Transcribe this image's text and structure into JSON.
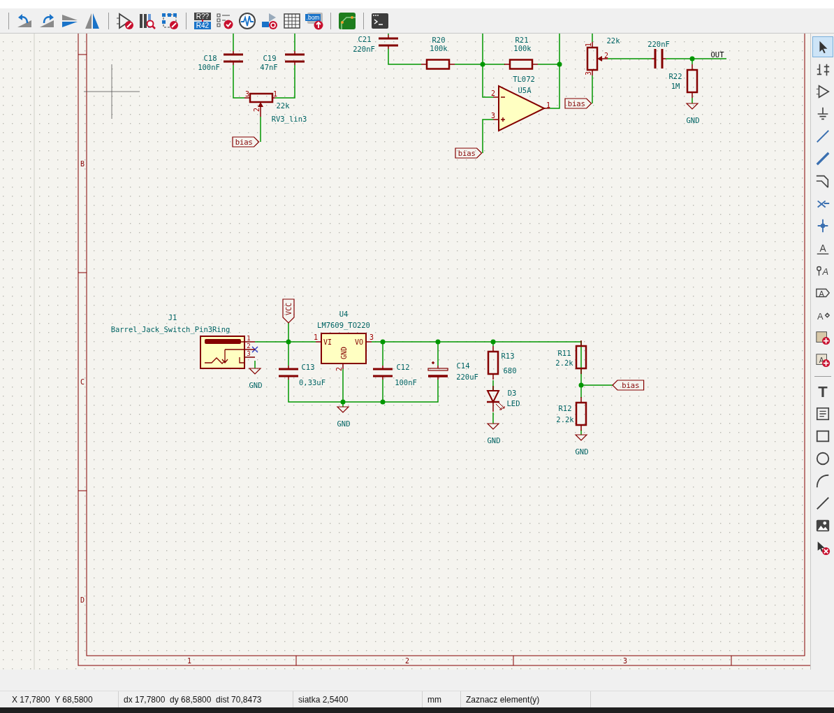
{
  "toolbar": {
    "annotate_icon": {
      "before": "R??",
      "after": "R42"
    },
    "bom_icon": ".bom"
  },
  "schematic": {
    "sheet": {
      "rows": [
        "B",
        "C",
        "D"
      ],
      "columns": [
        "1",
        "2",
        "3"
      ]
    },
    "components": [
      {
        "kind": "capacitor",
        "ref": "C18",
        "value": "100nF"
      },
      {
        "kind": "capacitor",
        "ref": "C19",
        "value": "47nF"
      },
      {
        "kind": "potentiometer",
        "ref": "RV3_lin3",
        "value": "22k",
        "pins": [
          "3",
          "1",
          "2"
        ]
      },
      {
        "kind": "capacitor",
        "ref": "C21",
        "value": "220nF"
      },
      {
        "kind": "resistor",
        "ref": "R20",
        "value": "100k"
      },
      {
        "kind": "resistor",
        "ref": "R21",
        "value": "100k"
      },
      {
        "kind": "opamp",
        "ref": "U5A",
        "value": "TL072",
        "pins": [
          "2",
          "3",
          "1"
        ]
      },
      {
        "kind": "potentiometer",
        "value": "22k",
        "pins": [
          "1",
          "3",
          "2"
        ]
      },
      {
        "kind": "capacitor",
        "value": "220nF"
      },
      {
        "kind": "resistor",
        "ref": "R22",
        "value": "1M"
      },
      {
        "kind": "barrel_jack",
        "ref": "J1",
        "value": "Barrel_Jack_Switch_Pin3Ring",
        "pins": [
          "1",
          "2",
          "3"
        ]
      },
      {
        "kind": "regulator",
        "ref": "U4",
        "value": "LM7609_TO220",
        "pins": [
          "1",
          "3",
          "2"
        ],
        "pin_names": [
          "VI",
          "VO",
          "GND"
        ]
      },
      {
        "kind": "capacitor",
        "ref": "C13",
        "value": "0,33uF"
      },
      {
        "kind": "capacitor",
        "ref": "C12",
        "value": "100nF"
      },
      {
        "kind": "polarized_capacitor",
        "ref": "C14",
        "value": "220uF"
      },
      {
        "kind": "resistor",
        "ref": "R13",
        "value": "680"
      },
      {
        "kind": "led",
        "ref": "D3",
        "value": "LED"
      },
      {
        "kind": "resistor",
        "ref": "R11",
        "value": "2.2k"
      },
      {
        "kind": "resistor",
        "ref": "R12",
        "value": "2.2k"
      }
    ],
    "labels": [
      {
        "kind": "hierarchical",
        "text": "bias"
      },
      {
        "kind": "hierarchical",
        "text": "bias"
      },
      {
        "kind": "hierarchical",
        "text": "bias"
      },
      {
        "kind": "hierarchical",
        "text": "bias"
      },
      {
        "kind": "net",
        "text": "OUT"
      }
    ],
    "power": [
      {
        "kind": "vcc",
        "text": "VCC"
      },
      {
        "kind": "gnd",
        "text": "GND"
      },
      {
        "kind": "gnd",
        "text": "GND"
      },
      {
        "kind": "gnd",
        "text": "GND"
      },
      {
        "kind": "gnd",
        "text": "GND"
      },
      {
        "kind": "gnd",
        "text": "GND"
      }
    ]
  },
  "right_toolbar": {
    "tools": [
      {
        "kind": "select",
        "selected": true
      },
      {
        "kind": "pin",
        "selected": false
      },
      {
        "kind": "symbol",
        "selected": false
      },
      {
        "kind": "power",
        "selected": false
      },
      {
        "kind": "wire",
        "selected": false
      },
      {
        "kind": "bus",
        "selected": false
      },
      {
        "kind": "bus_entry",
        "selected": false
      },
      {
        "kind": "no_connect",
        "selected": false
      },
      {
        "kind": "junction",
        "selected": false
      },
      {
        "kind": "label",
        "selected": false,
        "glyph": "A"
      },
      {
        "kind": "net_label",
        "selected": false,
        "glyph": "A"
      },
      {
        "kind": "global_label",
        "selected": false,
        "glyph": "A"
      },
      {
        "kind": "hier_label",
        "selected": false,
        "glyph": "A"
      },
      {
        "kind": "sheet",
        "selected": false
      },
      {
        "kind": "sheet_pin",
        "selected": false,
        "glyph": "A"
      },
      {
        "kind": "text",
        "selected": false,
        "glyph": "T"
      },
      {
        "kind": "text_box",
        "selected": false
      },
      {
        "kind": "rectangle",
        "selected": false
      },
      {
        "kind": "circle",
        "selected": false
      },
      {
        "kind": "arc",
        "selected": false
      },
      {
        "kind": "line",
        "selected": false
      },
      {
        "kind": "image",
        "selected": false
      },
      {
        "kind": "delete",
        "selected": false
      }
    ]
  },
  "status_bar": [
    "X 17,7800  Y 68,5800",
    "dx 17,7800  dy 68,5800  dist 70,8473",
    "siatka 2,5400",
    "mm",
    "Zaznacz element(y)"
  ]
}
